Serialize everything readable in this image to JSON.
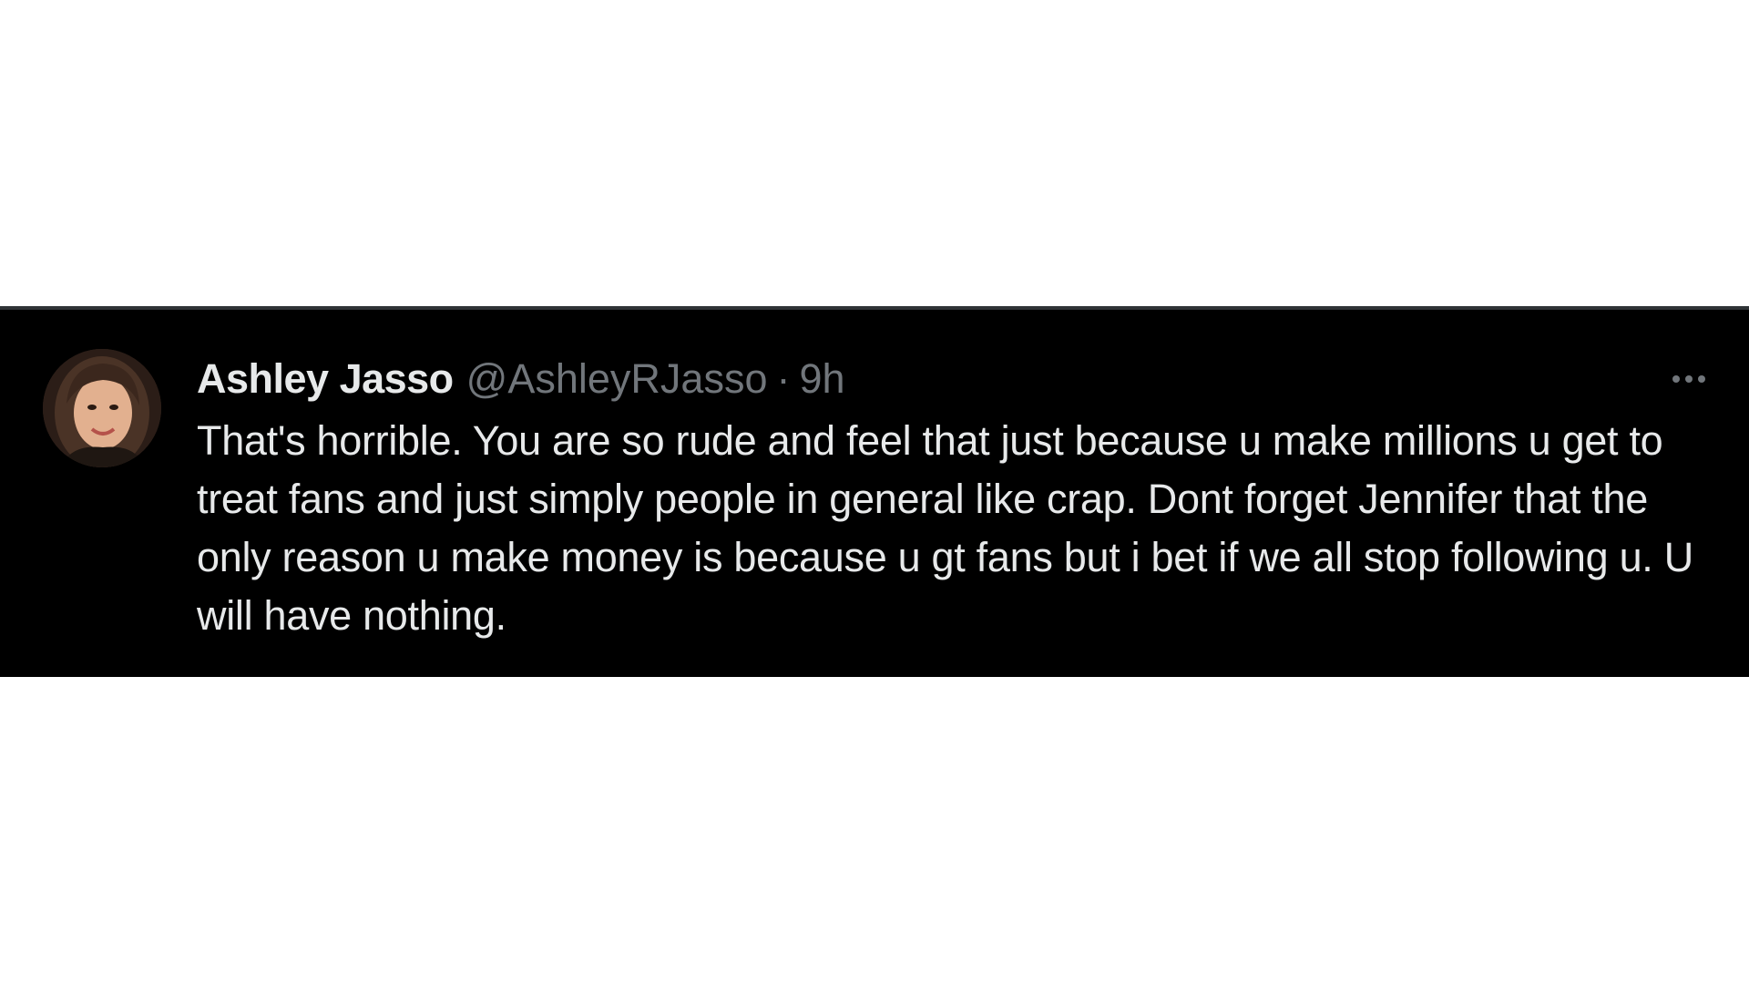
{
  "tweet": {
    "author": {
      "display_name": "Ashley Jasso",
      "handle": "@AshleyRJasso",
      "avatar_icon": "profile-photo"
    },
    "separator": "·",
    "timestamp": "9h",
    "more_icon": "ellipsis-icon",
    "text": "That's horrible. You are so rude and feel that just because u make millions u get to treat fans and just simply people in general like crap. Dont forget Jennifer that the only reason u make money is because u gt fans but i bet if we all stop following u. U will have nothing."
  },
  "colors": {
    "background": "#000000",
    "page_background": "#ffffff",
    "primary_text": "#e7e9ea",
    "secondary_text": "#71767b"
  }
}
